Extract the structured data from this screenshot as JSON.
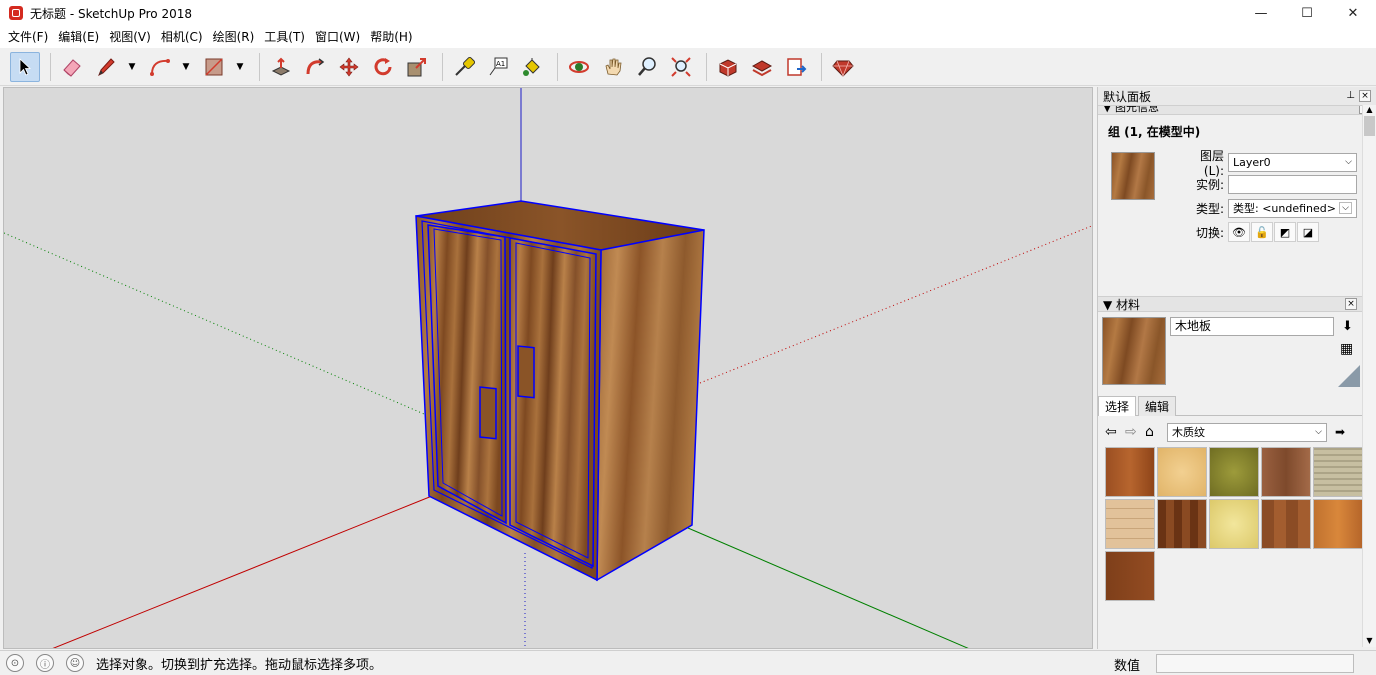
{
  "titlebar": {
    "title": "无标题 - SketchUp Pro 2018",
    "minimize": "—",
    "maximize": "☐",
    "close": "✕"
  },
  "menu": [
    "文件(F)",
    "编辑(E)",
    "视图(V)",
    "相机(C)",
    "绘图(R)",
    "工具(T)",
    "窗口(W)",
    "帮助(H)"
  ],
  "toolbar": {
    "tools": [
      "select-tool",
      "eraser-tool",
      "line-tool",
      "arc-tool",
      "shape-tool",
      "pushpull-tool",
      "followme-tool",
      "move-tool",
      "rotate-tool",
      "scale-tool",
      "tape-tool",
      "text-tool",
      "paint-tool",
      "orbit-tool",
      "pan-tool",
      "zoom-tool",
      "zoom-extents-tool",
      "warehouse-tool",
      "extension-warehouse-tool",
      "sendto-layout-tool",
      "ruby-tool"
    ],
    "dropdown_arrow": "▼"
  },
  "tray": {
    "title": "默认面板",
    "pin": "📌",
    "close": "×",
    "entity_info": {
      "section": "图元信息",
      "heading": "组 (1, 在模型中)",
      "layer_label": "图层(L):",
      "layer_value": "Layer0",
      "instance_label": "实例:",
      "instance_value": "",
      "type_label": "类型:",
      "type_value": "类型: <undefined>",
      "toggle_label": "切换:"
    },
    "materials": {
      "section": "材料",
      "name_value": "木地板",
      "tab_select": "选择",
      "tab_edit": "编辑",
      "library": "木质纹",
      "swatch_colors": [
        "#9b4f22",
        "#e9c27d",
        "#8a8a32",
        "#915b37",
        "#bdb69a",
        "#d8b68e",
        "#5e2e12",
        "#e8da85",
        "#8b4c25",
        "#c0722f",
        "#7e3f1a"
      ]
    }
  },
  "statusbar": {
    "message": "选择对象。切换到扩充选择。拖动鼠标选择多项。",
    "measure_label": "数值"
  },
  "colors": {
    "selection": "#0000ff",
    "axis_red": "#c00000",
    "axis_green": "#008000",
    "axis_blue": "#0000c8"
  }
}
